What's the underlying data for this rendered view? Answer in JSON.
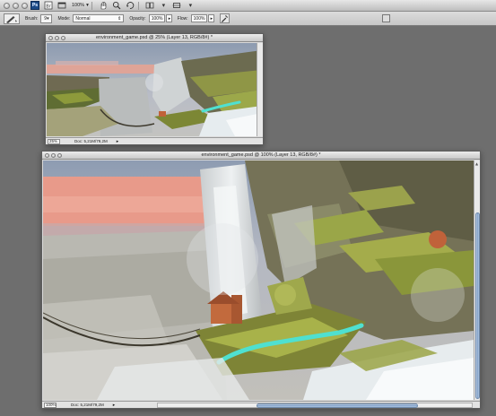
{
  "app": {
    "logo_text": "Ps",
    "zoom_level": "100%",
    "icons": [
      "photoshop-logo",
      "bridge-icon",
      "screen-mode-icon",
      "hand-tool-icon",
      "zoom-tool-icon",
      "rotate-view-icon",
      "arrange-documents-icon",
      "screen-options-icon"
    ]
  },
  "options": {
    "brush_label": "Brush:",
    "brush_size": "9",
    "mode_label": "Mode:",
    "mode_value": "Normal",
    "opacity_label": "Opacity:",
    "opacity_value": "100%",
    "flow_label": "Flow:",
    "flow_value": "100%"
  },
  "windows": [
    {
      "title": "environment_game.psd @ 25% (Layer 13, RGB/8#) *",
      "zoom": "25%",
      "doc_info": "Doc: 5,21M/79,2M"
    },
    {
      "title": "environment_game.psd @ 100% (Layer 13, RGB/8#) *",
      "zoom": "100%",
      "doc_info": "Doc: 5,21M/79,2M"
    }
  ],
  "colors": {
    "sky_glow": "#e99a8c",
    "brush_stroke": "#4fe0d0",
    "foliage": "#8f9a3e",
    "waterfall": "#d9dde0"
  }
}
